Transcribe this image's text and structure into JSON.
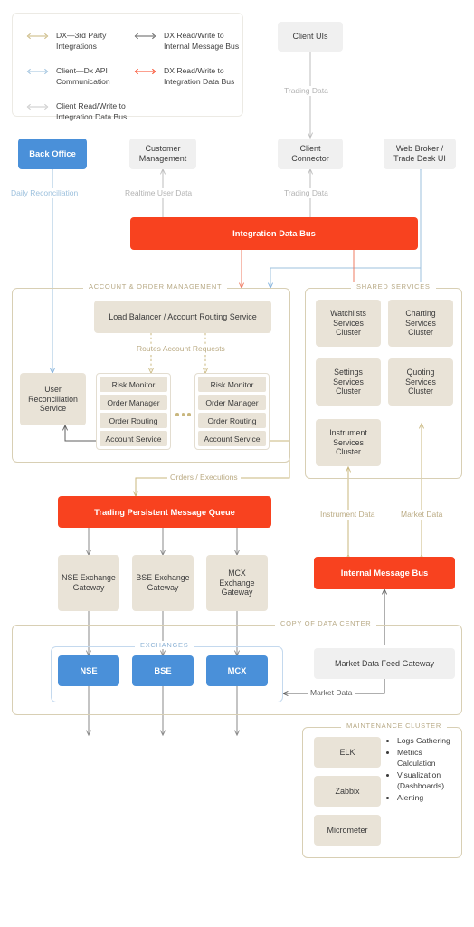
{
  "legend": {
    "items": [
      {
        "label": "DX—3rd Party Integrations",
        "color": "#c9b77e",
        "icon": "double-arrow-icon"
      },
      {
        "label": "DX Read/Write to Internal Message Bus",
        "color": "#5f5f5f",
        "icon": "double-arrow-icon"
      },
      {
        "label": "Client—Dx API Communication",
        "color": "#9cc0dd",
        "icon": "double-arrow-icon"
      },
      {
        "label": "DX Read/Write to Integration Data Bus",
        "color": "#f8421f",
        "icon": "double-arrow-icon"
      },
      {
        "label": "Client Read/Write to Integration Data Bus",
        "color": "#c9c9c9",
        "icon": "double-arrow-icon"
      }
    ]
  },
  "nodes": {
    "client_uis": "Client UIs",
    "back_office": "Back Office",
    "customer_management": "Customer Management",
    "client_connector": "Client Connector",
    "web_broker": "Web Broker / Trade Desk UI",
    "integration_data_bus": "Integration Data Bus",
    "load_balancer": "Load Balancer / Account Routing Service",
    "user_reconciliation": "User Reconciliation Service",
    "trading_queue": "Trading Persistent Message Queue",
    "internal_message_bus": "Internal Message Bus",
    "market_data_feed_gateway": "Market Data Feed Gateway",
    "nse_gateway": "NSE Exchange Gateway",
    "bse_gateway": "BSE Exchange Gateway",
    "mcx_gateway": "MCX Exchange Gateway",
    "nse": "NSE",
    "bse": "BSE",
    "mcx": "MCX",
    "elk": "ELK",
    "zabbix": "Zabbix",
    "micrometer": "Micrometer"
  },
  "groups": {
    "account_order_management": "ACCOUNT & ORDER MANAGEMENT",
    "shared_services": "SHARED SERVICES",
    "copy_of_data_center": "COPY OF DATA CENTER",
    "exchanges": "EXCHANGES",
    "maintenance_cluster": "MAINTENANCE CLUSTER"
  },
  "service_stack": {
    "rows": [
      "Risk Monitor",
      "Order Manager",
      "Order Routing",
      "Account Service"
    ],
    "ellipsis": "•••"
  },
  "shared_services_clusters": [
    "Watchlists Services Cluster",
    "Charting Services Cluster",
    "Settings Services Cluster",
    "Quoting Services Cluster",
    "Instrument Services Cluster"
  ],
  "maintenance_bullets": [
    "Logs Gathering",
    "Metrics Calculation",
    "Visualization (Dashboards)",
    "Alerting"
  ],
  "edge_labels": {
    "trading_data_top": "Trading Data",
    "daily_reconciliation": "Daily Reconciliation",
    "realtime_user_data": "Realtime User Data",
    "trading_data_mid": "Trading Data",
    "routes_account_requests": "Routes Account Requests",
    "orders_executions": "Orders / Executions",
    "instrument_data": "Instrument Data",
    "market_data_right": "Market Data",
    "market_data_bottom": "Market Data"
  },
  "colors": {
    "orange": "#f8421f",
    "blue": "#4a90d9",
    "beige": "#e9e3d7",
    "grey_box": "#f0f0f0",
    "tan_line": "#c9b77e",
    "grey_line": "#5f5f5f",
    "light_blue_line": "#9cc0dd",
    "pale_grey_line": "#c9c9c9"
  }
}
